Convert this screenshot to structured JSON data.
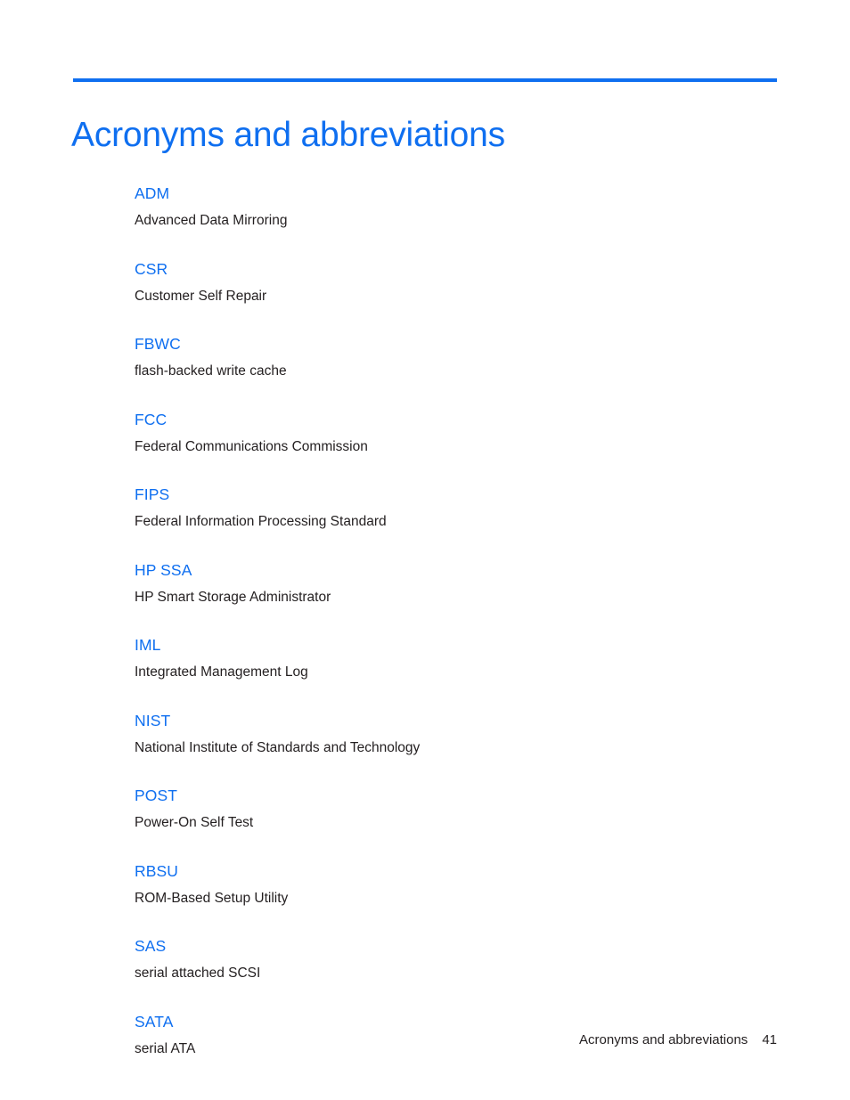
{
  "document": {
    "title": "Acronyms and abbreviations"
  },
  "theme": {
    "accent": "#0F6FF0",
    "text": "#231f20",
    "background": "#ffffff"
  },
  "header": {
    "title": "Acronyms and abbreviations"
  },
  "glossary": {
    "entries": [
      {
        "term": "ADM",
        "definition": "Advanced Data Mirroring"
      },
      {
        "term": "CSR",
        "definition": "Customer Self Repair"
      },
      {
        "term": "FBWC",
        "definition": "flash-backed write cache"
      },
      {
        "term": "FCC",
        "definition": "Federal Communications Commission"
      },
      {
        "term": "FIPS",
        "definition": "Federal Information Processing Standard"
      },
      {
        "term": "HP SSA",
        "definition": "HP Smart Storage Administrator"
      },
      {
        "term": "IML",
        "definition": "Integrated Management Log"
      },
      {
        "term": "NIST",
        "definition": "National Institute of Standards and Technology"
      },
      {
        "term": "POST",
        "definition": "Power-On Self Test"
      },
      {
        "term": "RBSU",
        "definition": "ROM-Based Setup Utility"
      },
      {
        "term": "SAS",
        "definition": "serial attached SCSI"
      },
      {
        "term": "SATA",
        "definition": "serial ATA"
      }
    ]
  },
  "footer": {
    "label": "Acronyms and abbreviations",
    "page_number": "41"
  }
}
